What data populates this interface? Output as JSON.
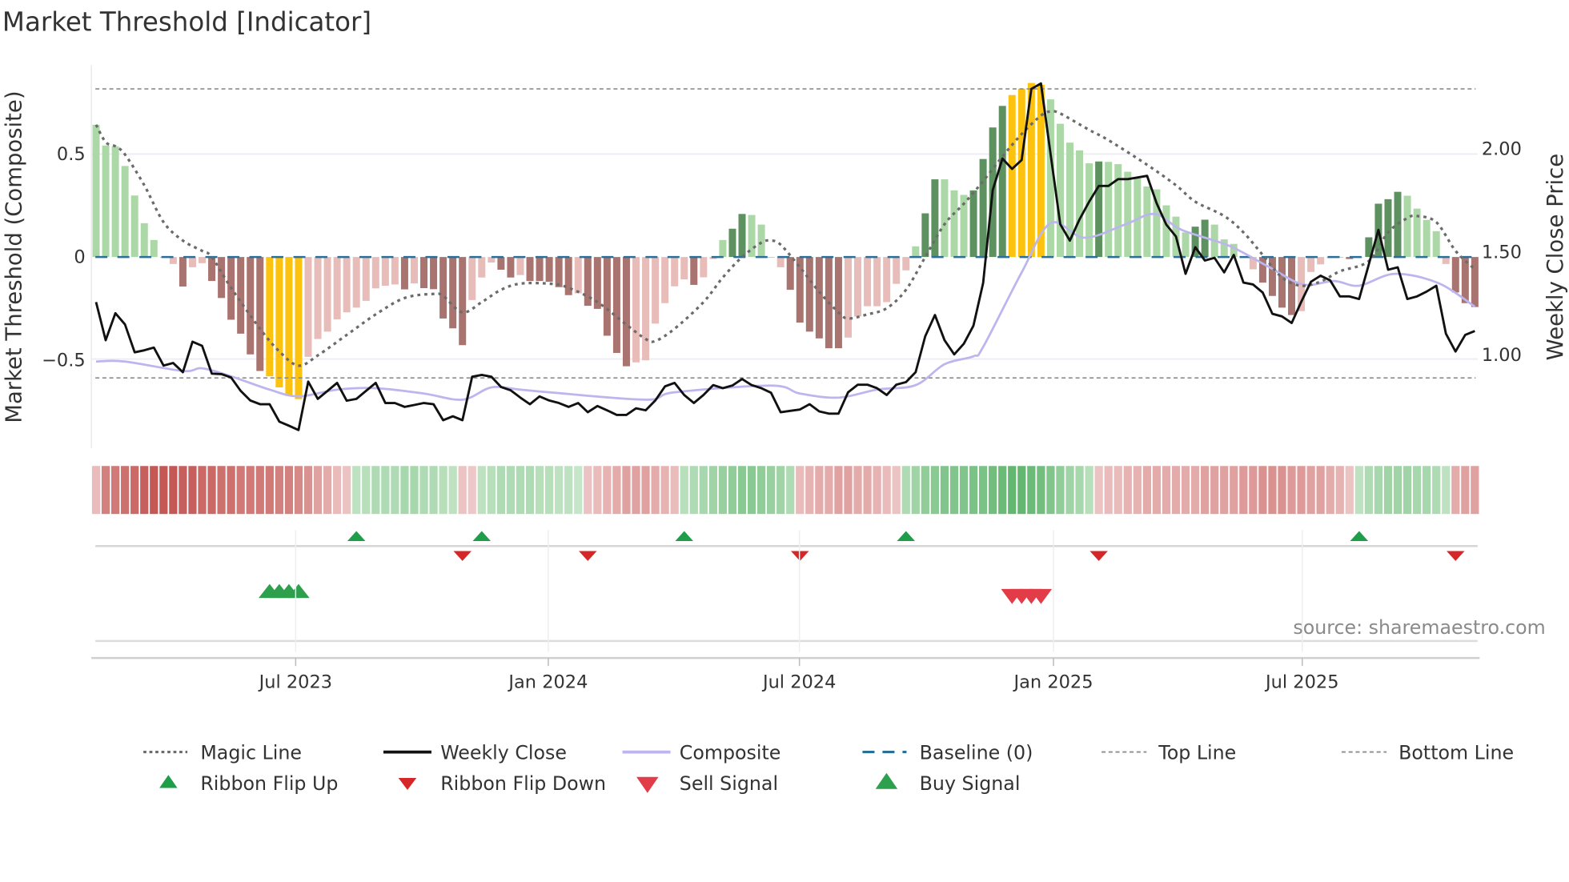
{
  "title": "Market Threshold [Indicator]",
  "source": "source: sharemaestro.com",
  "chart_data": {
    "type": "bar",
    "title": "Market Threshold [Indicator]",
    "ylabel": "Market Threshold (Composite)",
    "y2label": "Weekly Close Price",
    "x_unit": "week index (1 = first weekly bar, ~Feb 2023)",
    "ylim": [
      -0.9,
      0.95
    ],
    "y2lim": [
      0.6,
      2.45
    ],
    "yticks": [
      {
        "value": 0.5,
        "label": "0.5"
      },
      {
        "value": 0,
        "label": "0"
      },
      {
        "value": -0.5,
        "label": "−0.5"
      }
    ],
    "y2ticks": [
      {
        "value": 2.0,
        "label": "2.00"
      },
      {
        "value": 1.5,
        "label": "1.50"
      },
      {
        "value": 1.0,
        "label": "1.00"
      }
    ],
    "xticks": [
      {
        "week": 21.7,
        "label": "Jul 2023"
      },
      {
        "week": 47.9,
        "label": "Jan 2024"
      },
      {
        "week": 73.95,
        "label": "Jul 2024"
      },
      {
        "week": 100.3,
        "label": "Jan 2025"
      },
      {
        "week": 126.1,
        "label": "Jul 2025"
      }
    ],
    "top_line": 0.82,
    "bottom_line": -0.59,
    "baseline": 0,
    "colors": {
      "lg": "#acd8a7",
      "dg": "#5e9160",
      "lp": "#e8bcb8",
      "dp": "#a97470",
      "y": "#fdc20e",
      "magic": "#6b6b6b",
      "close": "#111111",
      "composite": "#bcb5ee",
      "baseline": "#2a6f97",
      "threshold": "#8c8c8c",
      "up": "#1f9e4a",
      "down": "#d62728",
      "buy": "#2ca04c",
      "sell": "#e23c48"
    },
    "composite_bars": [
      0.645,
      0.544,
      0.54,
      0.444,
      0.3,
      0.165,
      0.083,
      0.0,
      -0.034,
      -0.144,
      -0.05,
      -0.03,
      -0.117,
      -0.2,
      -0.306,
      -0.374,
      -0.475,
      -0.556,
      -0.582,
      -0.636,
      -0.677,
      -0.693,
      -0.487,
      -0.4,
      -0.364,
      -0.304,
      -0.27,
      -0.247,
      -0.214,
      -0.153,
      -0.14,
      -0.134,
      -0.158,
      -0.129,
      -0.152,
      -0.157,
      -0.3,
      -0.348,
      -0.43,
      -0.21,
      -0.1,
      -0.027,
      -0.062,
      -0.1,
      -0.088,
      -0.117,
      -0.117,
      -0.121,
      -0.147,
      -0.186,
      -0.177,
      -0.238,
      -0.253,
      -0.384,
      -0.468,
      -0.533,
      -0.514,
      -0.504,
      -0.325,
      -0.225,
      -0.143,
      -0.109,
      -0.136,
      -0.099,
      -0.01,
      0.083,
      0.138,
      0.21,
      0.205,
      0.158,
      0.0,
      -0.05,
      -0.16,
      -0.32,
      -0.364,
      -0.397,
      -0.445,
      -0.445,
      -0.393,
      -0.29,
      -0.24,
      -0.24,
      -0.22,
      -0.131,
      -0.065,
      0.052,
      0.213,
      0.379,
      0.379,
      0.325,
      0.303,
      0.325,
      0.478,
      0.632,
      0.737,
      0.79,
      0.821,
      0.849,
      0.84,
      0.769,
      0.65,
      0.558,
      0.52,
      0.457,
      0.466,
      0.464,
      0.453,
      0.416,
      0.383,
      0.344,
      0.33,
      0.252,
      0.197,
      0.12,
      0.148,
      0.182,
      0.158,
      0.086,
      0.064,
      0.0,
      -0.06,
      -0.125,
      -0.19,
      -0.247,
      -0.283,
      -0.264,
      -0.073,
      -0.036,
      -0.005,
      0.0,
      -0.01,
      0.0,
      0.096,
      0.26,
      0.282,
      0.318,
      0.299,
      0.236,
      0.181,
      0.126,
      -0.034,
      -0.173,
      -0.225,
      -0.244
    ],
    "bar_kinds": [
      "lg",
      "lg",
      "lg",
      "lg",
      "lg",
      "lg",
      "lg",
      "lg",
      "lp",
      "dp",
      "lp",
      "lp",
      "dp",
      "dp",
      "dp",
      "dp",
      "dp",
      "dp",
      "y",
      "y",
      "y",
      "y",
      "lp",
      "lp",
      "lp",
      "lp",
      "lp",
      "lp",
      "lp",
      "lp",
      "lp",
      "lp",
      "dp",
      "lp",
      "dp",
      "dp",
      "dp",
      "dp",
      "dp",
      "lp",
      "lp",
      "lp",
      "dp",
      "dp",
      "lp",
      "dp",
      "dp",
      "dp",
      "dp",
      "dp",
      "lp",
      "dp",
      "dp",
      "dp",
      "dp",
      "dp",
      "lp",
      "lp",
      "lp",
      "lp",
      "lp",
      "lp",
      "dp",
      "lp",
      "lp",
      "lg",
      "dg",
      "dg",
      "lg",
      "lg",
      "lg",
      "lp",
      "dp",
      "dp",
      "dp",
      "dp",
      "dp",
      "dp",
      "lp",
      "lp",
      "lp",
      "lp",
      "lp",
      "lp",
      "lp",
      "lg",
      "dg",
      "dg",
      "lg",
      "lg",
      "lg",
      "dg",
      "dg",
      "dg",
      "dg",
      "y",
      "y",
      "y",
      "y",
      "lg",
      "lg",
      "lg",
      "lg",
      "lg",
      "dg",
      "lg",
      "lg",
      "lg",
      "lg",
      "lg",
      "lg",
      "lg",
      "lg",
      "lg",
      "dg",
      "dg",
      "lg",
      "lg",
      "lg",
      "lg",
      "lp",
      "dp",
      "dp",
      "dp",
      "dp",
      "lp",
      "lp",
      "lp",
      "lp",
      "lp",
      "dp",
      "lg",
      "dg",
      "dg",
      "dg",
      "dg",
      "lg",
      "lg",
      "lg",
      "lg",
      "lp",
      "dp",
      "dp",
      "dp"
    ],
    "weekly_close": [
      1.28,
      1.094,
      1.226,
      1.171,
      1.035,
      1.045,
      1.058,
      0.97,
      0.983,
      0.938,
      1.087,
      1.067,
      0.931,
      0.929,
      0.912,
      0.847,
      0.8,
      0.782,
      0.782,
      0.697,
      0.677,
      0.656,
      0.892,
      0.808,
      0.847,
      0.886,
      0.799,
      0.808,
      0.847,
      0.886,
      0.788,
      0.788,
      0.769,
      0.778,
      0.788,
      0.782,
      0.704,
      0.723,
      0.704,
      0.916,
      0.925,
      0.916,
      0.866,
      0.85,
      0.814,
      0.782,
      0.82,
      0.8,
      0.788,
      0.769,
      0.788,
      0.743,
      0.773,
      0.752,
      0.73,
      0.73,
      0.762,
      0.752,
      0.8,
      0.869,
      0.886,
      0.827,
      0.788,
      0.827,
      0.875,
      0.86,
      0.873,
      0.905,
      0.875,
      0.86,
      0.838,
      0.743,
      0.75,
      0.756,
      0.782,
      0.747,
      0.736,
      0.736,
      0.84,
      0.877,
      0.877,
      0.86,
      0.827,
      0.877,
      0.89,
      0.938,
      1.113,
      1.217,
      1.094,
      1.025,
      1.077,
      1.165,
      1.373,
      1.827,
      1.98,
      1.93,
      1.973,
      2.32,
      2.347,
      2.0,
      1.66,
      1.58,
      1.684,
      1.77,
      1.847,
      1.847,
      1.88,
      1.88,
      1.888,
      1.896,
      1.762,
      1.658,
      1.6,
      1.418,
      1.548,
      1.483,
      1.496,
      1.425,
      1.51,
      1.375,
      1.366,
      1.327,
      1.223,
      1.21,
      1.178,
      1.282,
      1.379,
      1.409,
      1.386,
      1.308,
      1.308,
      1.295,
      1.464,
      1.632,
      1.438,
      1.45,
      1.295,
      1.308,
      1.331,
      1.36,
      1.126,
      1.039,
      1.12,
      1.139
    ],
    "magic_line": [
      [
        1,
        0.645
      ],
      [
        2,
        0.56
      ],
      [
        3,
        0.54
      ],
      [
        4,
        0.5
      ],
      [
        6,
        0.35
      ],
      [
        8,
        0.17
      ],
      [
        10,
        0.08
      ],
      [
        12,
        0.03
      ],
      [
        13,
        0
      ],
      [
        15,
        -0.15
      ],
      [
        18,
        -0.35
      ],
      [
        20,
        -0.46
      ],
      [
        22,
        -0.53
      ],
      [
        24,
        -0.48
      ],
      [
        27,
        -0.38
      ],
      [
        30,
        -0.28
      ],
      [
        33,
        -0.2
      ],
      [
        36,
        -0.18
      ],
      [
        37,
        -0.19
      ],
      [
        39,
        -0.27
      ],
      [
        41,
        -0.22
      ],
      [
        43,
        -0.16
      ],
      [
        45,
        -0.13
      ],
      [
        48,
        -0.13
      ],
      [
        50,
        -0.15
      ],
      [
        53,
        -0.22
      ],
      [
        56,
        -0.33
      ],
      [
        58,
        -0.4
      ],
      [
        59,
        -0.41
      ],
      [
        61,
        -0.35
      ],
      [
        64,
        -0.22
      ],
      [
        66,
        -0.1
      ],
      [
        68,
        0
      ],
      [
        70,
        0.07
      ],
      [
        71,
        0.08
      ],
      [
        72,
        0.06
      ],
      [
        74,
        -0.05
      ],
      [
        76,
        -0.17
      ],
      [
        78,
        -0.27
      ],
      [
        79,
        -0.3
      ],
      [
        81,
        -0.28
      ],
      [
        83,
        -0.25
      ],
      [
        85,
        -0.16
      ],
      [
        87,
        0
      ],
      [
        89,
        0.16
      ],
      [
        91,
        0.26
      ],
      [
        93,
        0.37
      ],
      [
        95,
        0.49
      ],
      [
        97,
        0.6
      ],
      [
        99,
        0.69
      ],
      [
        100,
        0.71
      ],
      [
        101,
        0.7
      ],
      [
        104,
        0.62
      ],
      [
        106,
        0.57
      ],
      [
        110,
        0.45
      ],
      [
        113,
        0.35
      ],
      [
        115,
        0.27
      ],
      [
        118,
        0.2
      ],
      [
        120,
        0.12
      ],
      [
        122,
        0.01
      ],
      [
        124,
        -0.1
      ],
      [
        126,
        -0.14
      ],
      [
        128,
        -0.12
      ],
      [
        130,
        -0.07
      ],
      [
        133,
        -0.02
      ],
      [
        135,
        0.12
      ],
      [
        137,
        0.19
      ],
      [
        138,
        0.2
      ],
      [
        140,
        0.17
      ],
      [
        142,
        0.03
      ],
      [
        144,
        -0.06
      ]
    ],
    "composite_line": [
      [
        1,
        0.99
      ],
      [
        4,
        0.99
      ],
      [
        10,
        0.944
      ],
      [
        12,
        0.957
      ],
      [
        15,
        0.918
      ],
      [
        19,
        0.853
      ],
      [
        22,
        0.82
      ],
      [
        26,
        0.853
      ],
      [
        30,
        0.86
      ],
      [
        35,
        0.834
      ],
      [
        39,
        0.804
      ],
      [
        42,
        0.864
      ],
      [
        45,
        0.853
      ],
      [
        48,
        0.84
      ],
      [
        58,
        0.804
      ],
      [
        61,
        0.84
      ],
      [
        71,
        0.873
      ],
      [
        74,
        0.834
      ],
      [
        78,
        0.814
      ],
      [
        82,
        0.853
      ],
      [
        86,
        0.875
      ],
      [
        89,
        0.977
      ],
      [
        92,
        1.016
      ],
      [
        93,
        1.061
      ],
      [
        97,
        1.425
      ],
      [
        100,
        1.665
      ],
      [
        103.5,
        1.594
      ],
      [
        107.7,
        1.658
      ],
      [
        110.8,
        1.71
      ],
      [
        113.6,
        1.632
      ],
      [
        118.5,
        1.555
      ],
      [
        122.7,
        1.45
      ],
      [
        126.2,
        1.366
      ],
      [
        129.4,
        1.383
      ],
      [
        132,
        1.36
      ],
      [
        135.7,
        1.418
      ],
      [
        140.2,
        1.373
      ],
      [
        144,
        1.258
      ]
    ],
    "ribbon": [
      -0.2,
      -0.55,
      -0.6,
      -0.65,
      -0.7,
      -0.75,
      -0.8,
      -0.8,
      -0.8,
      -0.75,
      -0.75,
      -0.7,
      -0.7,
      -0.65,
      -0.65,
      -0.6,
      -0.6,
      -0.6,
      -0.6,
      -0.55,
      -0.55,
      -0.5,
      -0.45,
      -0.35,
      -0.3,
      -0.2,
      -0.15,
      0.2,
      0.25,
      0.3,
      0.3,
      0.3,
      0.35,
      0.35,
      0.3,
      0.3,
      0.25,
      0.2,
      -0.15,
      -0.12,
      0.2,
      0.25,
      0.3,
      0.3,
      0.3,
      0.3,
      0.25,
      0.25,
      0.2,
      0.2,
      0.15,
      -0.15,
      -0.2,
      -0.25,
      -0.3,
      -0.35,
      -0.35,
      -0.35,
      -0.3,
      -0.25,
      -0.2,
      0.25,
      0.3,
      0.35,
      0.4,
      0.45,
      0.5,
      0.55,
      0.55,
      0.5,
      0.45,
      0.4,
      0.3,
      -0.2,
      -0.25,
      -0.3,
      -0.3,
      -0.35,
      -0.35,
      -0.3,
      -0.3,
      -0.25,
      -0.2,
      -0.15,
      0.3,
      0.4,
      0.5,
      0.55,
      0.6,
      0.6,
      0.6,
      0.65,
      0.65,
      0.7,
      0.75,
      0.8,
      0.8,
      0.75,
      0.7,
      0.6,
      0.5,
      0.4,
      0.35,
      0.25,
      -0.15,
      -0.2,
      -0.2,
      -0.25,
      -0.25,
      -0.3,
      -0.3,
      -0.3,
      -0.3,
      -0.3,
      -0.3,
      -0.35,
      -0.35,
      -0.35,
      -0.35,
      -0.4,
      -0.4,
      -0.45,
      -0.45,
      -0.45,
      -0.4,
      -0.4,
      -0.35,
      -0.35,
      -0.3,
      -0.25,
      -0.15,
      0.2,
      0.3,
      0.35,
      0.4,
      0.4,
      0.4,
      0.35,
      0.35,
      0.3,
      0.2,
      -0.3,
      -0.35,
      -0.35
    ],
    "ribbon_flip_up": [
      28,
      41,
      62,
      85,
      132
    ],
    "ribbon_flip_down": [
      39,
      52,
      74,
      105,
      142
    ],
    "buy_signals": [
      19,
      20,
      21,
      22
    ],
    "sell_signals": [
      96,
      97,
      98,
      99
    ]
  },
  "legend": [
    {
      "key": "magic",
      "label": "Magic Line"
    },
    {
      "key": "close",
      "label": "Weekly Close"
    },
    {
      "key": "composite",
      "label": "Composite"
    },
    {
      "key": "baseline",
      "label": "Baseline (0)"
    },
    {
      "key": "top",
      "label": "Top Line"
    },
    {
      "key": "bottom",
      "label": "Bottom Line"
    },
    {
      "key": "flipup",
      "label": "Ribbon Flip Up"
    },
    {
      "key": "flipdown",
      "label": "Ribbon Flip Down"
    },
    {
      "key": "sell",
      "label": "Sell Signal"
    },
    {
      "key": "buy",
      "label": "Buy Signal"
    }
  ]
}
